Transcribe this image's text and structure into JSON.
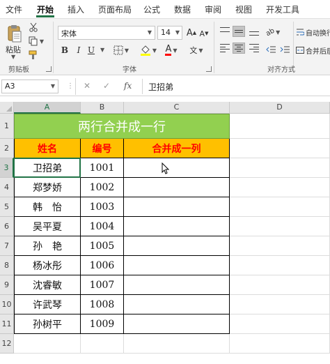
{
  "ribbon_tabs": [
    "文件",
    "开始",
    "插入",
    "页面布局",
    "公式",
    "数据",
    "审阅",
    "视图",
    "开发工具"
  ],
  "active_tab": "开始",
  "clipboard": {
    "paste_label": "粘贴",
    "group_label": "剪贴板"
  },
  "font": {
    "name": "宋体",
    "size": "14",
    "group_label": "字体",
    "bold": "B",
    "italic": "I",
    "underline": "U"
  },
  "alignment": {
    "group_label": "对齐方式",
    "wrap_label": "自动换行",
    "merge_label": "合并后居中"
  },
  "formula_bar": {
    "name_box": "A3",
    "fx_label": "fx",
    "value": "卫招弟"
  },
  "columns": [
    "A",
    "B",
    "C",
    "D"
  ],
  "rows": [
    "1",
    "2",
    "3",
    "4",
    "5",
    "6",
    "7",
    "8",
    "9",
    "10",
    "11",
    "12"
  ],
  "table": {
    "title": "两行合并成一行",
    "headers": [
      "姓名",
      "编号",
      "合并成一列"
    ],
    "records": [
      [
        "卫招弟",
        "1001",
        ""
      ],
      [
        "郑梦娇",
        "1002",
        ""
      ],
      [
        "韩　怡",
        "1003",
        ""
      ],
      [
        "吴平夏",
        "1004",
        ""
      ],
      [
        "孙　艳",
        "1005",
        ""
      ],
      [
        "杨冰彤",
        "1006",
        ""
      ],
      [
        "沈睿敏",
        "1007",
        ""
      ],
      [
        "许武琴",
        "1008",
        ""
      ],
      [
        "孙树平",
        "1009",
        ""
      ]
    ]
  },
  "colors": {
    "accent": "#217346",
    "title_fill": "#92d050",
    "header_fill": "#ffc000",
    "header_text": "#ff0000"
  }
}
